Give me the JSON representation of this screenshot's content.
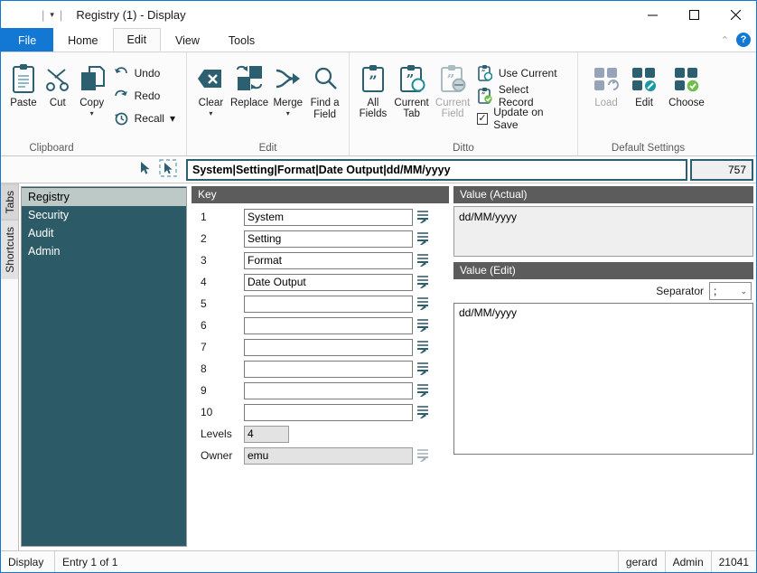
{
  "window": {
    "title": "Registry (1) - Display",
    "quick_access_caret": "▾",
    "minimize_label": "Minimize",
    "maximize_label": "Maximize",
    "close_label": "Close"
  },
  "ribbon": {
    "tabs": [
      {
        "label": "File",
        "active": false
      },
      {
        "label": "Home",
        "active": false
      },
      {
        "label": "Edit",
        "active": true
      },
      {
        "label": "View",
        "active": false
      },
      {
        "label": "Tools",
        "active": false
      }
    ],
    "collapse_chevron": "⌃",
    "help_label": "?",
    "groups": [
      {
        "name": "Clipboard",
        "label": "Clipboard",
        "big_buttons": [
          {
            "label": "Paste",
            "icon": "paste-icon",
            "dropdown": false,
            "disabled": false
          },
          {
            "label": "Cut",
            "icon": "cut-icon",
            "dropdown": false,
            "disabled": false
          },
          {
            "label": "Copy",
            "icon": "copy-icon",
            "dropdown": true,
            "disabled": false
          }
        ],
        "small_buttons": [
          {
            "label": "Undo",
            "icon": "undo-icon",
            "dropdown": false
          },
          {
            "label": "Redo",
            "icon": "redo-icon",
            "dropdown": false
          },
          {
            "label": "Recall",
            "icon": "recall-icon",
            "dropdown": true
          }
        ]
      },
      {
        "name": "Edit",
        "label": "Edit",
        "big_buttons": [
          {
            "label": "Clear",
            "icon": "clear-icon",
            "dropdown": true,
            "disabled": false
          },
          {
            "label": "Replace",
            "icon": "replace-icon",
            "dropdown": false,
            "disabled": false
          },
          {
            "label": "Merge",
            "icon": "merge-icon",
            "dropdown": true,
            "disabled": false
          },
          {
            "label": "Find a Field",
            "icon": "find-field-icon",
            "dropdown": false,
            "disabled": false
          }
        ],
        "small_buttons": []
      },
      {
        "name": "Ditto",
        "label": "Ditto",
        "big_buttons": [
          {
            "label": "All Fields",
            "icon": "all-fields-icon",
            "dropdown": false,
            "disabled": false
          },
          {
            "label": "Current Tab",
            "icon": "current-tab-icon",
            "dropdown": false,
            "disabled": false
          },
          {
            "label": "Current Field",
            "icon": "current-field-icon",
            "dropdown": false,
            "disabled": true
          }
        ],
        "small_buttons": [
          {
            "label": "Use Current",
            "icon": "use-current-icon",
            "checkbox": false,
            "checked": false
          },
          {
            "label": "Select Record",
            "icon": "select-record-icon",
            "checkbox": false,
            "checked": false
          },
          {
            "label": "Update on Save",
            "icon": "checkbox-icon",
            "checkbox": true,
            "checked": true
          }
        ]
      },
      {
        "name": "Default Settings",
        "label": "Default Settings",
        "big_buttons": [
          {
            "label": "Load",
            "icon": "load-settings-icon",
            "dropdown": false,
            "disabled": true
          },
          {
            "label": "Edit",
            "icon": "edit-settings-icon",
            "dropdown": false,
            "disabled": false
          },
          {
            "label": "Choose",
            "icon": "choose-settings-icon",
            "dropdown": false,
            "disabled": false
          }
        ],
        "small_buttons": []
      }
    ]
  },
  "command_bar": {
    "pointer_icon": "pointer-icon",
    "pointer_select_icon": "pointer-select-icon",
    "address_value": "System|Setting|Format|Date Output|dd/MM/yyyy",
    "record_count": "757"
  },
  "sidebar": {
    "vertical_tabs": [
      {
        "label": "Tabs",
        "active": true
      },
      {
        "label": "Shortcuts",
        "active": false
      }
    ],
    "items": [
      {
        "label": "Registry",
        "selected": true
      },
      {
        "label": "Security",
        "selected": false
      },
      {
        "label": "Audit",
        "selected": false
      },
      {
        "label": "Admin",
        "selected": false
      }
    ]
  },
  "key_panel": {
    "header": "Key",
    "rows": [
      {
        "num": "1",
        "value": "System",
        "readonly": false,
        "icon": "field-editor-icon"
      },
      {
        "num": "2",
        "value": "Setting",
        "readonly": false,
        "icon": "field-editor-icon"
      },
      {
        "num": "3",
        "value": "Format",
        "readonly": false,
        "icon": "field-editor-icon"
      },
      {
        "num": "4",
        "value": "Date Output",
        "readonly": false,
        "icon": "field-editor-icon"
      },
      {
        "num": "5",
        "value": "",
        "readonly": false,
        "icon": "field-editor-icon"
      },
      {
        "num": "6",
        "value": "",
        "readonly": false,
        "icon": "field-editor-icon"
      },
      {
        "num": "7",
        "value": "",
        "readonly": false,
        "icon": "field-editor-icon"
      },
      {
        "num": "8",
        "value": "",
        "readonly": false,
        "icon": "field-editor-icon"
      },
      {
        "num": "9",
        "value": "",
        "readonly": false,
        "icon": "field-editor-icon"
      },
      {
        "num": "10",
        "value": "",
        "readonly": false,
        "icon": "field-editor-icon"
      }
    ],
    "levels": {
      "label": "Levels",
      "value": "4",
      "readonly": true
    },
    "owner": {
      "label": "Owner",
      "value": "emu",
      "readonly": true,
      "icon": "field-editor-icon"
    }
  },
  "value_panel": {
    "actual_header": "Value (Actual)",
    "actual_value": "dd/MM/yyyy",
    "edit_header": "Value (Edit)",
    "separator_label": "Separator",
    "separator_value": ";",
    "separator_chevron": "⌄",
    "edit_value": "dd/MM/yyyy"
  },
  "status_bar": {
    "mode": "Display",
    "entry": "Entry 1 of 1",
    "user": "gerard",
    "role": "Admin",
    "id": "21041"
  },
  "colors": {
    "accent_blue": "#1378d4",
    "teal": "#2c5f6f",
    "nav_background": "#2c5a66",
    "panel_header": "#5c5c5c",
    "selected_nav": "#bcc9c6",
    "green_check": "#6fc04a"
  }
}
